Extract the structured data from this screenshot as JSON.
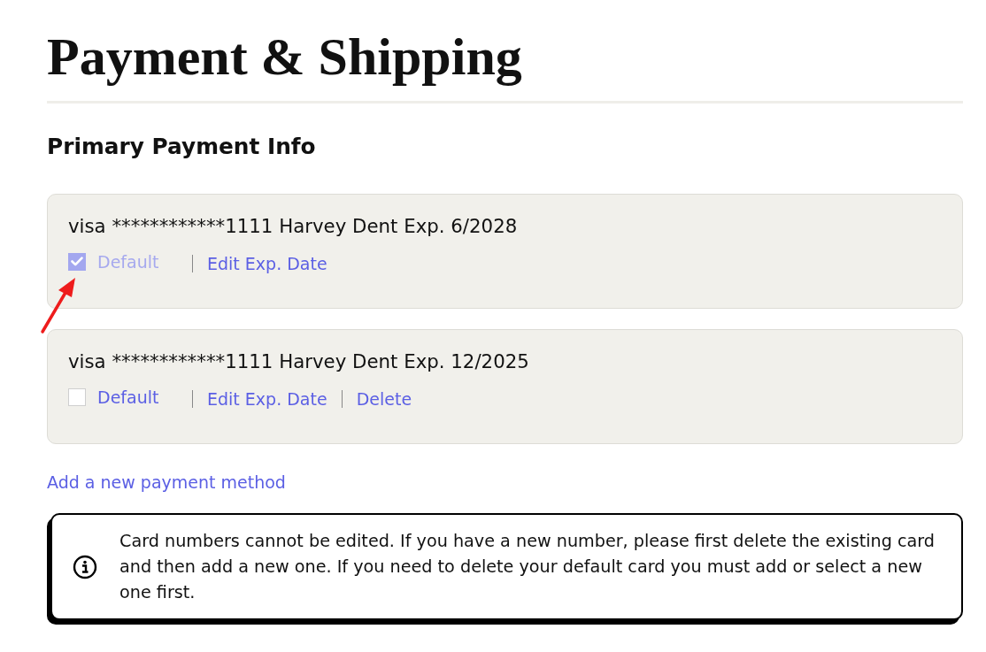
{
  "page": {
    "title": "Payment & Shipping"
  },
  "section": {
    "heading": "Primary Payment Info"
  },
  "cards": [
    {
      "summary": "visa ************1111 Harvey Dent Exp. 6/2028",
      "default_option": {
        "label": "Default",
        "checked": true,
        "disabled": true
      },
      "actions": [
        "Edit Exp. Date"
      ]
    },
    {
      "summary": "visa ************1111 Harvey Dent Exp. 12/2025",
      "default_option": {
        "label": "Default",
        "checked": false,
        "disabled": false
      },
      "actions": [
        "Edit Exp. Date",
        "Delete"
      ]
    }
  ],
  "add_link": "Add a new payment method",
  "notice": {
    "text": "Card numbers cannot be edited. If you have a new number, please first delete the existing card and then add a new one. If you need to delete your default card you must add or select a new one first."
  }
}
